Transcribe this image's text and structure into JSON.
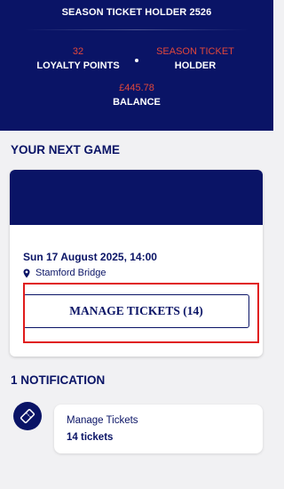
{
  "header": {
    "title": "SEASON TICKET HOLDER 2526",
    "loyalty": {
      "value": "32",
      "label": "LOYALTY POINTS"
    },
    "membership": {
      "value": "SEASON TICKET",
      "label": "HOLDER"
    },
    "balance": {
      "value": "£445.78",
      "label": "BALANCE"
    },
    "colors": {
      "background": "#0a1466",
      "accent": "#e0473b"
    }
  },
  "next_game": {
    "section_title": "YOUR NEXT GAME",
    "date_time": "Sun 17 August 2025, 14:00",
    "venue": "Stamford Bridge",
    "venue_icon": "location-pin-icon",
    "button_label": "MANAGE TICKETS (14)"
  },
  "notifications": {
    "section_title": "1 NOTIFICATION",
    "icon": "ticket-icon",
    "items": [
      {
        "title": "Manage Tickets",
        "subtitle": "14 tickets"
      }
    ]
  },
  "highlight_color": "#e01b1b"
}
